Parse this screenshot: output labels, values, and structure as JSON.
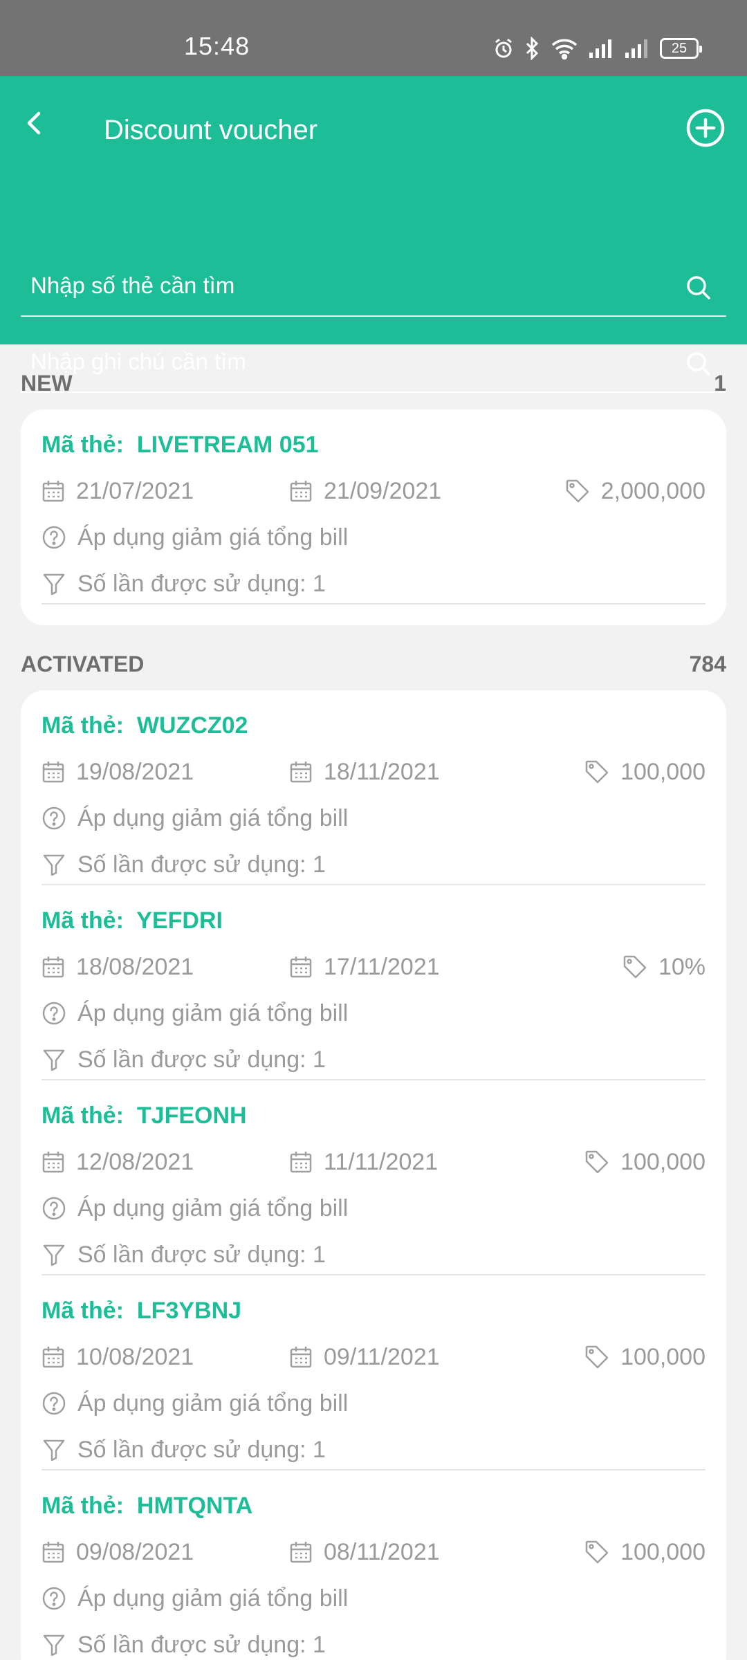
{
  "status_bar": {
    "time": "15:48",
    "battery": "25"
  },
  "header": {
    "title": "Discount voucher",
    "search_card_placeholder": "Nhập số thẻ cần tìm",
    "search_note_placeholder": "Nhập ghi chú cần tìm"
  },
  "sections": {
    "new": {
      "label": "NEW",
      "count": "1"
    },
    "activated": {
      "label": "ACTIVATED",
      "count": "784"
    }
  },
  "code_prefix": "Mã thẻ:",
  "apply_text": "Áp dụng giảm giá tổng bill",
  "usage_text": "Số lần được sử dụng: 1",
  "new_items": [
    {
      "code": "LIVETREAM 051",
      "start": "21/07/2021",
      "end": "21/09/2021",
      "value": "2,000,000"
    }
  ],
  "activated_items": [
    {
      "code": "WUZCZ02",
      "start": "19/08/2021",
      "end": "18/11/2021",
      "value": "100,000"
    },
    {
      "code": "YEFDRI",
      "start": "18/08/2021",
      "end": "17/11/2021",
      "value": "10%"
    },
    {
      "code": "TJFEONH",
      "start": "12/08/2021",
      "end": "11/11/2021",
      "value": "100,000"
    },
    {
      "code": "LF3YBNJ",
      "start": "10/08/2021",
      "end": "09/11/2021",
      "value": "100,000"
    },
    {
      "code": "HMTQNTA",
      "start": "09/08/2021",
      "end": "08/11/2021",
      "value": "100,000"
    }
  ],
  "colors": {
    "accent": "#1dbd98",
    "status_bar": "#737373",
    "background": "#f2f2f2",
    "muted_text": "#9a9a9a"
  }
}
